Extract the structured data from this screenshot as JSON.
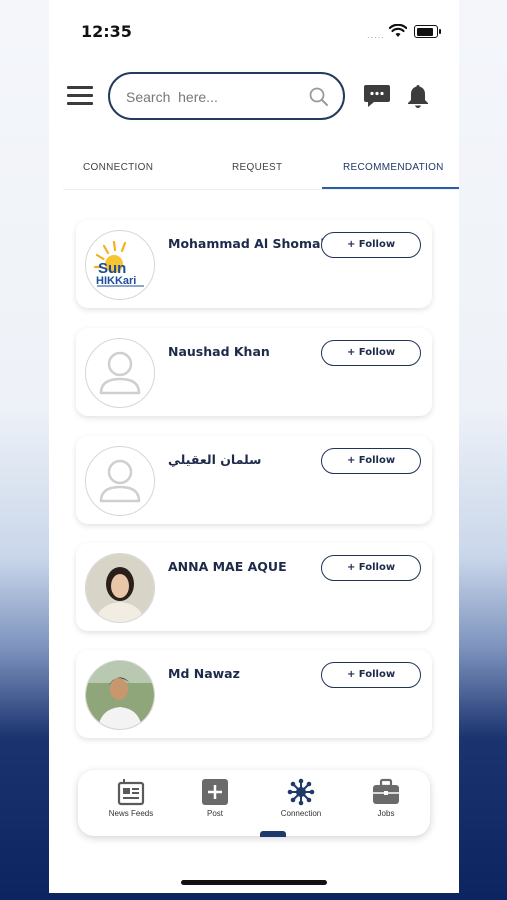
{
  "status_bar": {
    "time": "12:35",
    "signal": "....."
  },
  "search": {
    "placeholder": "Search  here..."
  },
  "tabs": [
    {
      "label": "CONNECTION",
      "active": false
    },
    {
      "label": "REQUEST",
      "active": false
    },
    {
      "label": "RECOMMENDATION",
      "active": true
    }
  ],
  "recommendations": [
    {
      "name": "Mohammad Al Shomali",
      "avatar": "sun-hikkari-logo",
      "logo_top": "Sun",
      "logo_bottom": "HIKKari",
      "follow_label": "+ Follow"
    },
    {
      "name": "Naushad Khan",
      "avatar": "default-user-icon",
      "follow_label": "+ Follow"
    },
    {
      "name": "سلمان العقيلي",
      "avatar": "default-user-icon",
      "follow_label": "+ Follow"
    },
    {
      "name": "ANNA MAE AQUE",
      "avatar": "profile-photo",
      "follow_label": "+ Follow"
    },
    {
      "name": "Md Nawaz",
      "avatar": "profile-photo",
      "follow_label": "+ Follow"
    }
  ],
  "bottom_nav": [
    {
      "label": "News Feeds",
      "icon": "newspaper-icon",
      "active": false
    },
    {
      "label": "Post",
      "icon": "plus-square-icon",
      "active": false
    },
    {
      "label": "Connection",
      "icon": "network-icon",
      "active": true
    },
    {
      "label": "Jobs",
      "icon": "briefcase-icon",
      "active": false
    }
  ],
  "colors": {
    "accent": "#1f3a68",
    "tab_underline": "#2a5fa8",
    "text_dark": "#1d2a4a"
  }
}
